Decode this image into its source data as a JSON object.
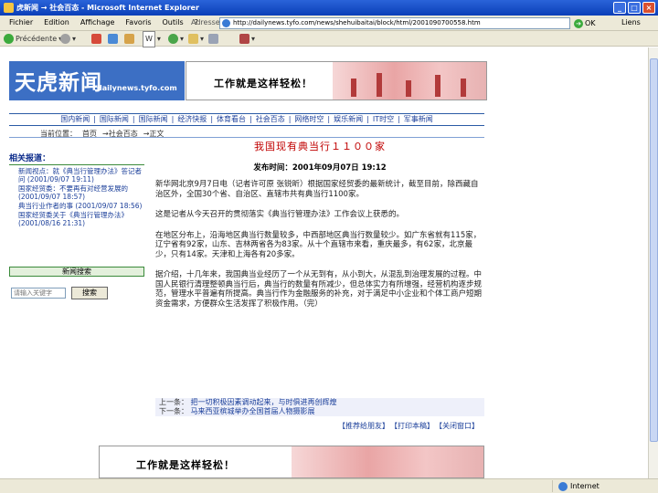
{
  "window": {
    "title": "虎新闻 → 社会百态 - Microsoft Internet Explorer"
  },
  "menubar": {
    "items": [
      "Fichier",
      "Edition",
      "Affichage",
      "Favoris",
      "Outils",
      "?"
    ],
    "address_label": "Adresse",
    "address_url": "http://dailynews.tyfo.com/news/shehuibaitai/block/html/2001090700558.htm",
    "go_label": "OK",
    "links_label": "Liens"
  },
  "toolbar": {
    "back": "Précédente",
    "favorites_label": "W"
  },
  "site": {
    "logo_text": "天虎新闻",
    "logo_domain": "dailynews.tyfo.com",
    "banner_slogan": "工作就是这样轻松！"
  },
  "nav": {
    "items": [
      "国内新闻",
      "国际新闻",
      "国际新闻",
      "经济快报",
      "体育看台",
      "社会百态",
      "网络时空",
      "娱乐新闻",
      "IT时空",
      "军事新闻"
    ],
    "breadcrumb": [
      "当前位置：",
      "首页",
      "→社会百态",
      "→正文"
    ]
  },
  "sidebar": {
    "related_title": "相关报道：",
    "related": [
      "新闻视点：就《典当行管理办法》答记者问  (2001/09/07 19:11)",
      "国家经贸委：不要再有对经营发展的 (2001/09/07 18:57)",
      "典当行业作者的事 (2001/09/07 18:56)",
      "国家经贸委关于《典当行管理办法》 (2001/08/16 21:31)"
    ],
    "search_title": "新闻搜索",
    "search_placeholder": "请输入关键字",
    "search_button": "搜索"
  },
  "article": {
    "title": "我国现有典当行１１００家",
    "meta": "发布时间：2001年09月07日 19:12",
    "paragraphs": [
      "新华网北京9月7日电（记者许可原 张锐昕）根据国家经贸委的最新统计，截至目前，除西藏自治区外，全国30个省、自治区、直辖市共有典当行1100家。",
      "这是记者从今天召开的贯彻落实《典当行管理办法》工作会议上获悉的。",
      "在地区分布上，沿海地区典当行数量较多，中西部地区典当行数量较少。如广东省就有115家，辽宁省有92家，山东、吉林两省各为83家。从十个直辖市来看，重庆最多，有62家，北京最少，只有14家。天津和上海各有20多家。",
      "据介绍，十几年来，我国典当业经历了一个从无到有，从小到大，从混乱到治理发展的过程。中国人民银行清理整顿典当行后，典当行的数量有所减少，但总体实力有所增强，经营机构逐步规范，管理水平普遍有所提高。典当行作为金融服务的补充，对于满足中小企业和个体工商户短期资金需求，方便群众生活发挥了积极作用。（完）"
    ]
  },
  "related_box": {
    "prev_label": "上一条：",
    "prev_text": "把一切积极因素调动起来，与时俱进再创辉煌",
    "next_label": "下一条：",
    "next_text": "马来西亚槟城举办全国首届人物摄影展"
  },
  "footer_links": [
    "【推荐给朋友】",
    "【打印本稿】",
    "【关闭窗口】"
  ],
  "bottom_banner_slogan": "工作就是这样轻松！",
  "status": {
    "zone": "Internet"
  }
}
